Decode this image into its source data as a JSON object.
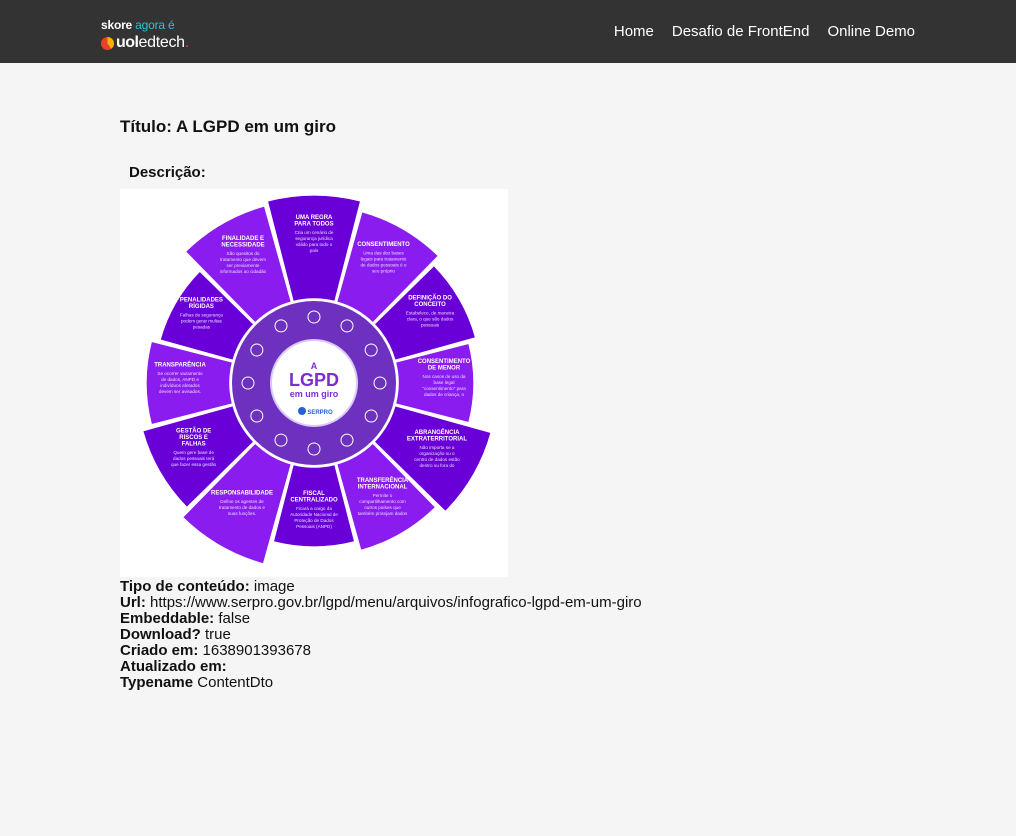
{
  "header": {
    "logo": {
      "line1_brand": "skore",
      "line1_rest": " agora é",
      "line2_uol": "uol",
      "line2_edtech": "edtech",
      "line2_dot": "."
    },
    "nav": [
      {
        "label": "Home"
      },
      {
        "label": "Desafio de FrontEnd"
      },
      {
        "label": "Online Demo"
      }
    ]
  },
  "content": {
    "title": "Título: A LGPD em um giro",
    "description_label": "Descrição:",
    "infographic": {
      "center_top": "A",
      "center_main": "LGPD",
      "center_sub": "em um giro",
      "center_brand": "SERPRO",
      "segments": [
        {
          "title": "UMA REGRA PARA TODOS",
          "text": "Cria um cenário de segurança jurídica válido para todo o país"
        },
        {
          "title": "CONSENTIMENTO",
          "text": "Uma das dez bases legais para tratamento de dados pessoais é o seu próprio consentimento."
        },
        {
          "title": "DEFINIÇÃO DO CONCEITO",
          "text": "Estabelece, de maneira clara, o que são dados pessoais"
        },
        {
          "title": "CONSENTIMENTO DE MENOR",
          "text": "Nos casos de uso da base legal \"consentimento\" para dados de criança, o consentimento deverá ser dos pais ou do responsável."
        },
        {
          "title": "ABRANGÊNCIA EXTRATERRITORIAL",
          "text": "Não importa se a organização ou o centro de dados estão dentro ou fora do Brasil."
        },
        {
          "title": "TRANSFERÊNCIA INTERNACIONAL",
          "text": "Permite o compartilhamento com outros países que também protejam dados"
        },
        {
          "title": "FISCAL CENTRALIZADO",
          "text": "Ficará a cargo da Autoridade Nacional de Proteção de Dados Pessoais (ANPD)"
        },
        {
          "title": "RESPONSABILIDADE",
          "text": "Define os agentes de tratamento de dados e suas funções."
        },
        {
          "title": "GESTÃO DE RISCOS E FALHAS",
          "text": "Quem gere base de dados pessoais terá que fazer essa gestão"
        },
        {
          "title": "TRANSPARÊNCIA",
          "text": "Se ocorrer vazamento de dados, ANPD e indivíduos afetados devem ser avisados."
        },
        {
          "title": "PENALIDADES RÍGIDAS",
          "text": "Falhas de segurança podem gerar multas pesadas"
        },
        {
          "title": "FINALIDADE E NECESSIDADE",
          "text": "São quesitos do tratamento que devem ser previamente informados ao cidadão"
        }
      ]
    },
    "meta": [
      {
        "label": "Tipo de conteúdo:",
        "value": "image"
      },
      {
        "label": "Url:",
        "value": "https://www.serpro.gov.br/lgpd/menu/arquivos/infografico-lgpd-em-um-giro"
      },
      {
        "label": "Embeddable:",
        "value": "false"
      },
      {
        "label": "Download?",
        "value": "true"
      },
      {
        "label": "Criado em:",
        "value": "1638901393678"
      },
      {
        "label": "Atualizado em:",
        "value": ""
      },
      {
        "label": "Typename",
        "value": "ContentDto"
      }
    ]
  },
  "colors": {
    "topbar": "#333333",
    "background": "#f5f5f5",
    "wheel_dark": "#6a00d8",
    "wheel_light": "#8a1cf0",
    "accent_red": "#e8432a"
  }
}
